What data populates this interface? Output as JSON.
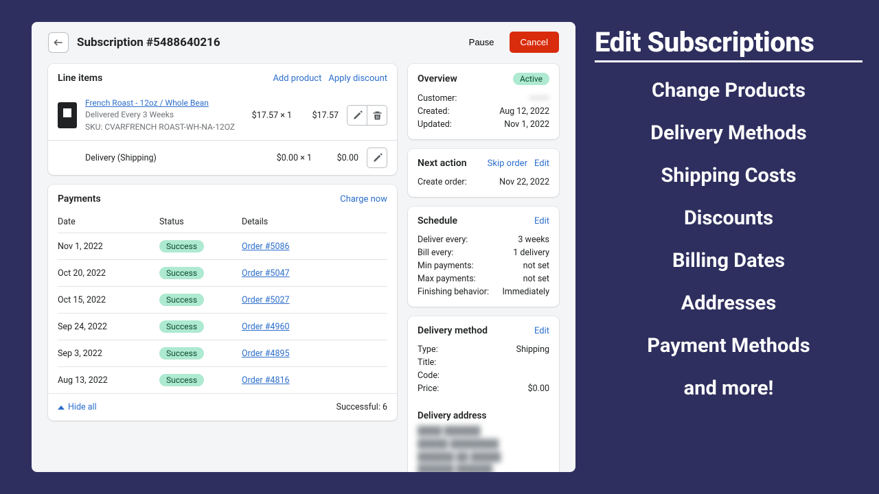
{
  "header": {
    "title": "Subscription #5488640216",
    "pause": "Pause",
    "cancel": "Cancel"
  },
  "lineItems": {
    "heading": "Line items",
    "addProduct": "Add product",
    "applyDiscount": "Apply discount",
    "item": {
      "name": "French Roast - 12oz / Whole Bean",
      "delivered": "Delivered Every 3 Weeks",
      "sku": "SKU: CVARFRENCH ROAST-WH-NA-12OZ",
      "unit": "$17.57 × 1",
      "total": "$17.57"
    },
    "delivery": {
      "label": "Delivery (Shipping)",
      "unit": "$0.00 × 1",
      "total": "$0.00"
    }
  },
  "payments": {
    "heading": "Payments",
    "chargeNow": "Charge now",
    "cols": {
      "date": "Date",
      "status": "Status",
      "details": "Details"
    },
    "rows": [
      {
        "date": "Nov 1, 2022",
        "status": "Success",
        "order": "Order #5086"
      },
      {
        "date": "Oct 20, 2022",
        "status": "Success",
        "order": "Order #5047"
      },
      {
        "date": "Oct 15, 2022",
        "status": "Success",
        "order": "Order #5027"
      },
      {
        "date": "Sep 24, 2022",
        "status": "Success",
        "order": "Order #4960"
      },
      {
        "date": "Sep 3, 2022",
        "status": "Success",
        "order": "Order #4895"
      },
      {
        "date": "Aug 13, 2022",
        "status": "Success",
        "order": "Order #4816"
      }
    ],
    "hideAll": "Hide all",
    "summary": "Successful: 6"
  },
  "overview": {
    "heading": "Overview",
    "status": "Active",
    "customerLabel": "Customer:",
    "customerValue": "———",
    "createdLabel": "Created:",
    "createdValue": "Aug 12, 2022",
    "updatedLabel": "Updated:",
    "updatedValue": "Nov 1, 2022"
  },
  "nextAction": {
    "heading": "Next action",
    "skip": "Skip order",
    "edit": "Edit",
    "createLabel": "Create order:",
    "createValue": "Nov 22, 2022"
  },
  "schedule": {
    "heading": "Schedule",
    "edit": "Edit",
    "deliverLabel": "Deliver every:",
    "deliverValue": "3 weeks",
    "billLabel": "Bill every:",
    "billValue": "1 delivery",
    "minLabel": "Min payments:",
    "minValue": "not set",
    "maxLabel": "Max payments:",
    "maxValue": "not set",
    "finishLabel": "Finishing behavior:",
    "finishValue": "Immediately"
  },
  "deliveryMethod": {
    "heading": "Delivery method",
    "edit": "Edit",
    "typeLabel": "Type:",
    "typeValue": "Shipping",
    "titleLabel": "Title:",
    "titleValue": "",
    "codeLabel": "Code:",
    "codeValue": "",
    "priceLabel": "Price:",
    "priceValue": "$0.00",
    "addressHeading": "Delivery address"
  },
  "sidebar": {
    "title": "Edit Subscriptions",
    "items": [
      "Change Products",
      "Delivery Methods",
      "Shipping Costs",
      "Discounts",
      "Billing Dates",
      "Addresses",
      "Payment Methods",
      "and more!"
    ]
  }
}
